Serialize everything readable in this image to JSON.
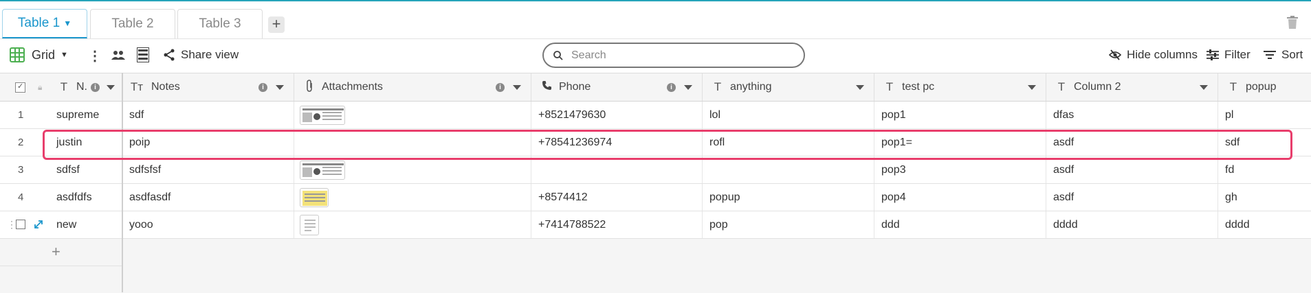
{
  "tabs": [
    {
      "label": "Table 1",
      "active": true
    },
    {
      "label": "Table 2",
      "active": false
    },
    {
      "label": "Table 3",
      "active": false
    }
  ],
  "add_tab_label": "+",
  "toolbar": {
    "view_label": "Grid",
    "share_label": "Share view",
    "search_placeholder": "Search",
    "hide_columns_label": "Hide columns",
    "filter_label": "Filter",
    "sort_label": "Sort"
  },
  "columns": [
    {
      "label": "N.",
      "icon": "T"
    },
    {
      "label": "Notes",
      "icon": "Tт"
    },
    {
      "label": "Attachments",
      "icon": "paperclip"
    },
    {
      "label": "Phone",
      "icon": "phone"
    },
    {
      "label": "anything",
      "icon": "T"
    },
    {
      "label": "test pc",
      "icon": "T"
    },
    {
      "label": "Column 2",
      "icon": "T"
    },
    {
      "label": "popup",
      "icon": "T"
    }
  ],
  "rows": [
    {
      "num": "1",
      "name": "supreme",
      "notes": "sdf",
      "attachment": "image",
      "phone": "+8521479630",
      "anything": "lol",
      "testpc": "pop1",
      "col2": "dfas",
      "popup": "pl"
    },
    {
      "num": "2",
      "name": "justin",
      "notes": "poip",
      "attachment": "",
      "phone": "+78541236974",
      "anything": "rofl",
      "testpc": "pop1=",
      "col2": "asdf",
      "popup": "sdf"
    },
    {
      "num": "3",
      "name": "sdfsf",
      "notes": "sdfsfsf",
      "attachment": "image",
      "phone": "",
      "anything": "",
      "testpc": "pop3",
      "col2": "asdf",
      "popup": "fd"
    },
    {
      "num": "4",
      "name": "asdfdfs",
      "notes": "asdfasdf",
      "attachment": "image-small",
      "phone": "+8574412",
      "anything": "popup",
      "testpc": "pop4",
      "col2": "asdf",
      "popup": "gh"
    },
    {
      "num": "",
      "name": "new",
      "notes": "yooo",
      "attachment": "document",
      "phone": "+7414788522",
      "anything": "pop",
      "testpc": "ddd",
      "col2": "dddd",
      "popup": "dddd"
    }
  ],
  "add_row_label": "+",
  "colors": {
    "accent": "#1a96cc",
    "highlight": "#e83e6c",
    "grid_icon": "#4caf50"
  }
}
